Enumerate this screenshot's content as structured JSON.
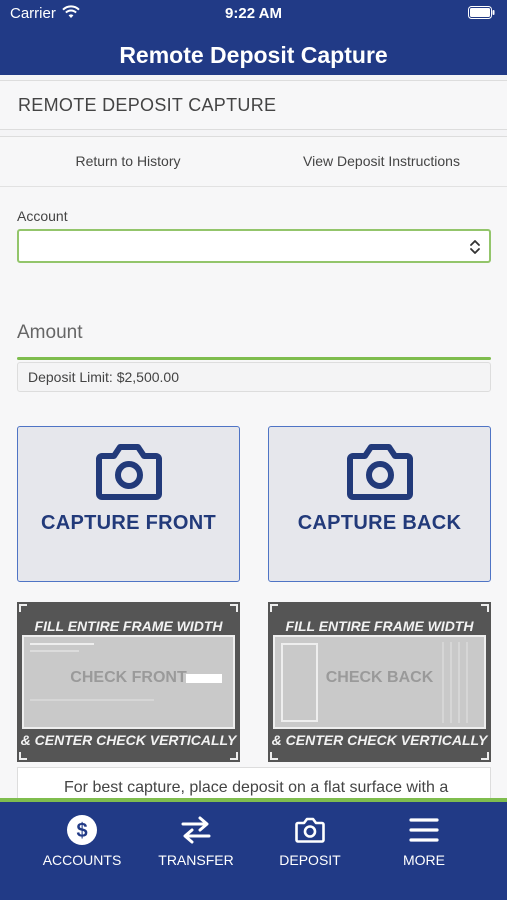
{
  "status_bar": {
    "carrier": "Carrier",
    "time": "9:22 AM"
  },
  "nav": {
    "title": "Remote Deposit Capture"
  },
  "section": {
    "header": "REMOTE DEPOSIT CAPTURE"
  },
  "links": {
    "history": "Return to History",
    "instructions": "View Deposit Instructions"
  },
  "form": {
    "account_label": "Account",
    "account_value": "",
    "amount_placeholder": "Amount",
    "deposit_limit": "Deposit Limit: $2,500.00"
  },
  "capture": {
    "front_label": "CAPTURE FRONT",
    "back_label": "CAPTURE BACK"
  },
  "guides": {
    "top_text": "FILL ENTIRE FRAME WIDTH",
    "bottom_text": "& CENTER CHECK VERTICALLY",
    "front_text": "CHECK FRONT",
    "back_text": "CHECK BACK"
  },
  "tip": "For best capture, place deposit on a flat surface with a",
  "tabs": [
    {
      "label": "ACCOUNTS",
      "icon": "dollar-circle-icon"
    },
    {
      "label": "TRANSFER",
      "icon": "transfer-arrows-icon"
    },
    {
      "label": "DEPOSIT",
      "icon": "camera-icon"
    },
    {
      "label": "MORE",
      "icon": "menu-icon"
    }
  ],
  "colors": {
    "brand": "#213a86",
    "accent": "#7fbd4e",
    "capture_text": "#223a7a"
  }
}
